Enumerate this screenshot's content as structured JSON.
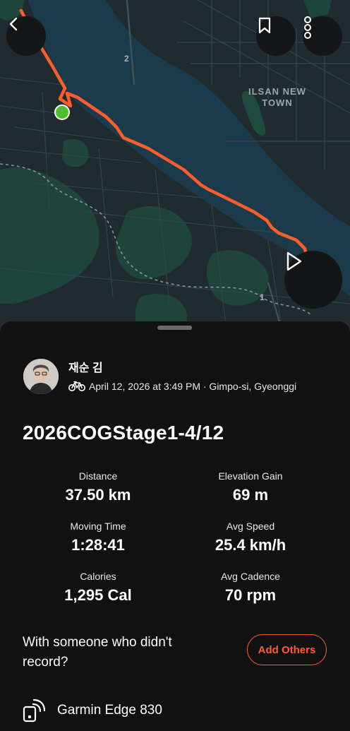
{
  "map": {
    "labels": {
      "area_line1": "ILSAN NEW",
      "area_line2": "TOWN",
      "road_number_a": "2",
      "road_number_b": "1"
    },
    "route_color": "#fc5e2b",
    "start_marker_color": "#4cc02a"
  },
  "controls": {
    "back_icon": "chevron-left-icon",
    "bookmark_icon": "bookmark-icon",
    "more_icon": "more-vertical-icon",
    "play_icon": "play-icon"
  },
  "athlete": {
    "name": "재순 김",
    "activity_icon": "bike-icon",
    "date_location": "April 12, 2026 at 3:49 PM · Gimpo-si, Gyeonggi"
  },
  "activity": {
    "title": "2026COGStage1-4/12"
  },
  "stats": [
    {
      "label": "Distance",
      "value": "37.50 km"
    },
    {
      "label": "Elevation Gain",
      "value": "69 m"
    },
    {
      "label": "Moving Time",
      "value": "1:28:41"
    },
    {
      "label": "Avg Speed",
      "value": "25.4 km/h"
    },
    {
      "label": "Calories",
      "value": "1,295 Cal"
    },
    {
      "label": "Avg Cadence",
      "value": "70 rpm"
    }
  ],
  "with_others": {
    "prompt": "With someone who didn't record?",
    "button_label": "Add Others"
  },
  "device": {
    "icon": "device-icon",
    "name": "Garmin Edge 830"
  },
  "colors": {
    "accent": "#fc5e2b",
    "background": "#111112"
  }
}
